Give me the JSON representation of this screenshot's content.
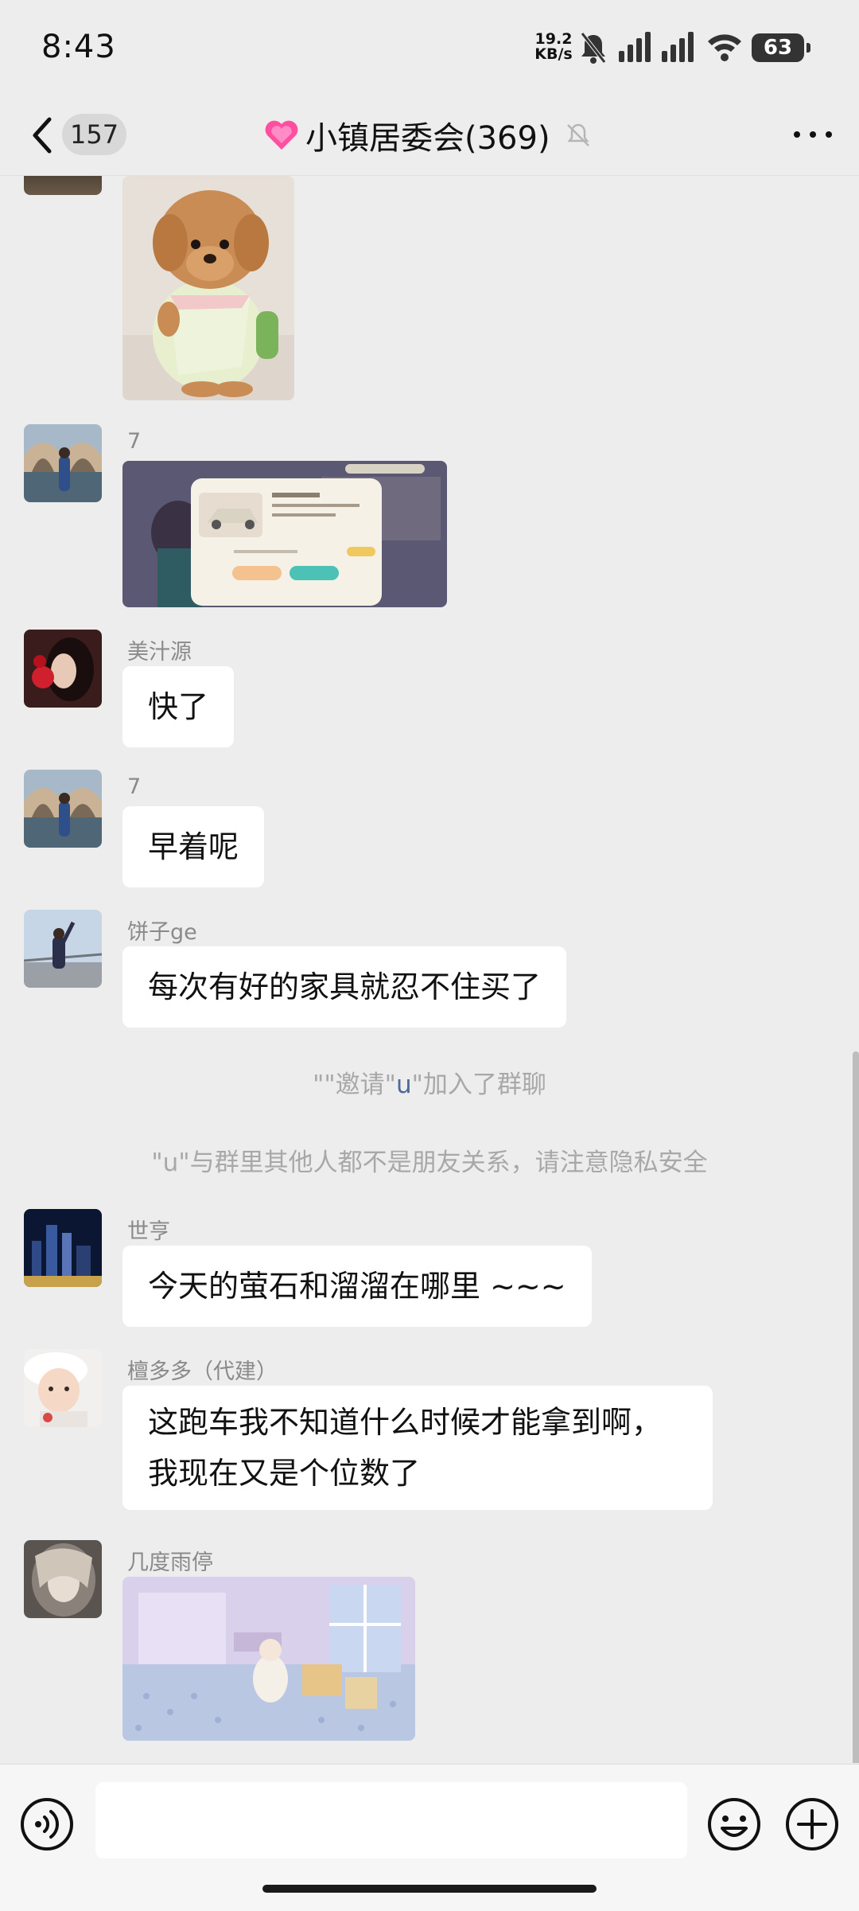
{
  "status_bar": {
    "time": "8:43",
    "net_rate": "19.2",
    "net_unit": "KB/s",
    "battery": "63",
    "icons": [
      "bell-off-icon",
      "signal-icon",
      "signal-icon",
      "wifi-icon",
      "battery-icon"
    ]
  },
  "header": {
    "unread": "157",
    "title": "小镇居委会(369)",
    "icons": [
      "back-icon",
      "heart-emoji-icon",
      "mute-icon",
      "more-icon"
    ]
  },
  "messages": [
    {
      "type": "image",
      "sender": "",
      "image": "plush-toy-dog-photo"
    },
    {
      "type": "image",
      "sender": "7",
      "image": "game-screenshot-car-purchase"
    },
    {
      "type": "text",
      "sender": "美汁源",
      "text": "快了"
    },
    {
      "type": "text",
      "sender": "7",
      "text": "早着呢"
    },
    {
      "type": "text",
      "sender": "饼子ge",
      "text": "每次有好的家具就忍不住买了"
    },
    {
      "type": "system",
      "parts": [
        "\"",
        "\"邀请\"",
        "u",
        "\"加入了群聊"
      ]
    },
    {
      "type": "system",
      "text": "\"u\"与群里其他人都不是朋友关系，请注意隐私安全"
    },
    {
      "type": "text",
      "sender": "世亨",
      "text": "今天的萤石和溜溜在哪里 ~~~"
    },
    {
      "type": "text",
      "sender": "檀多多（代建）",
      "lines": [
        "这跑车我不知道什么时候才能拿到啊，",
        "我现在又是个位数了"
      ]
    },
    {
      "type": "image",
      "sender": "几度雨停",
      "image": "game-screenshot-room"
    }
  ],
  "input_bar": {
    "placeholder": "",
    "icons": [
      "voice-icon",
      "emoji-icon",
      "plus-icon"
    ]
  },
  "colors": {
    "background": "#ededed",
    "bubble": "#ffffff",
    "system_text": "#a8a8a8",
    "link_blue": "#4c6b96"
  }
}
